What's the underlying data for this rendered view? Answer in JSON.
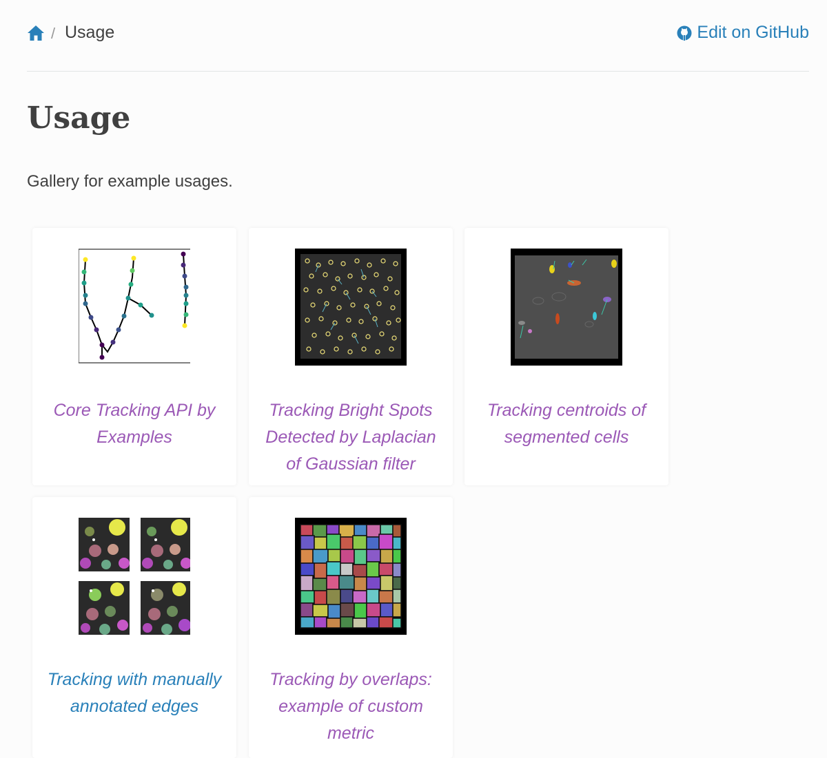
{
  "breadcrumb": {
    "home_icon": "home-icon",
    "separator": "/",
    "current": "Usage",
    "edit_link": "Edit on GitHub",
    "edit_icon": "github-icon"
  },
  "title": "Usage",
  "intro": "Gallery for example usages.",
  "colors": {
    "link": "#2980b9",
    "visited_link": "#9b59b6",
    "text": "#404040"
  },
  "gallery": [
    {
      "title": "Core Tracking API by Examples",
      "thumbnail": "tracking-graph-thumbnail",
      "visited": true
    },
    {
      "title": "Tracking Bright Spots Detected by Laplacian of Gaussian filter",
      "thumbnail": "bright-spots-thumbnail",
      "visited": true
    },
    {
      "title": "Tracking centroids of segmented cells",
      "thumbnail": "segmented-cells-thumbnail",
      "visited": true
    },
    {
      "title": "Tracking with manually annotated edges",
      "thumbnail": "annotated-edges-thumbnail",
      "visited": false
    },
    {
      "title": "Tracking by overlaps: example of custom metric",
      "thumbnail": "overlaps-thumbnail",
      "visited": true
    }
  ]
}
